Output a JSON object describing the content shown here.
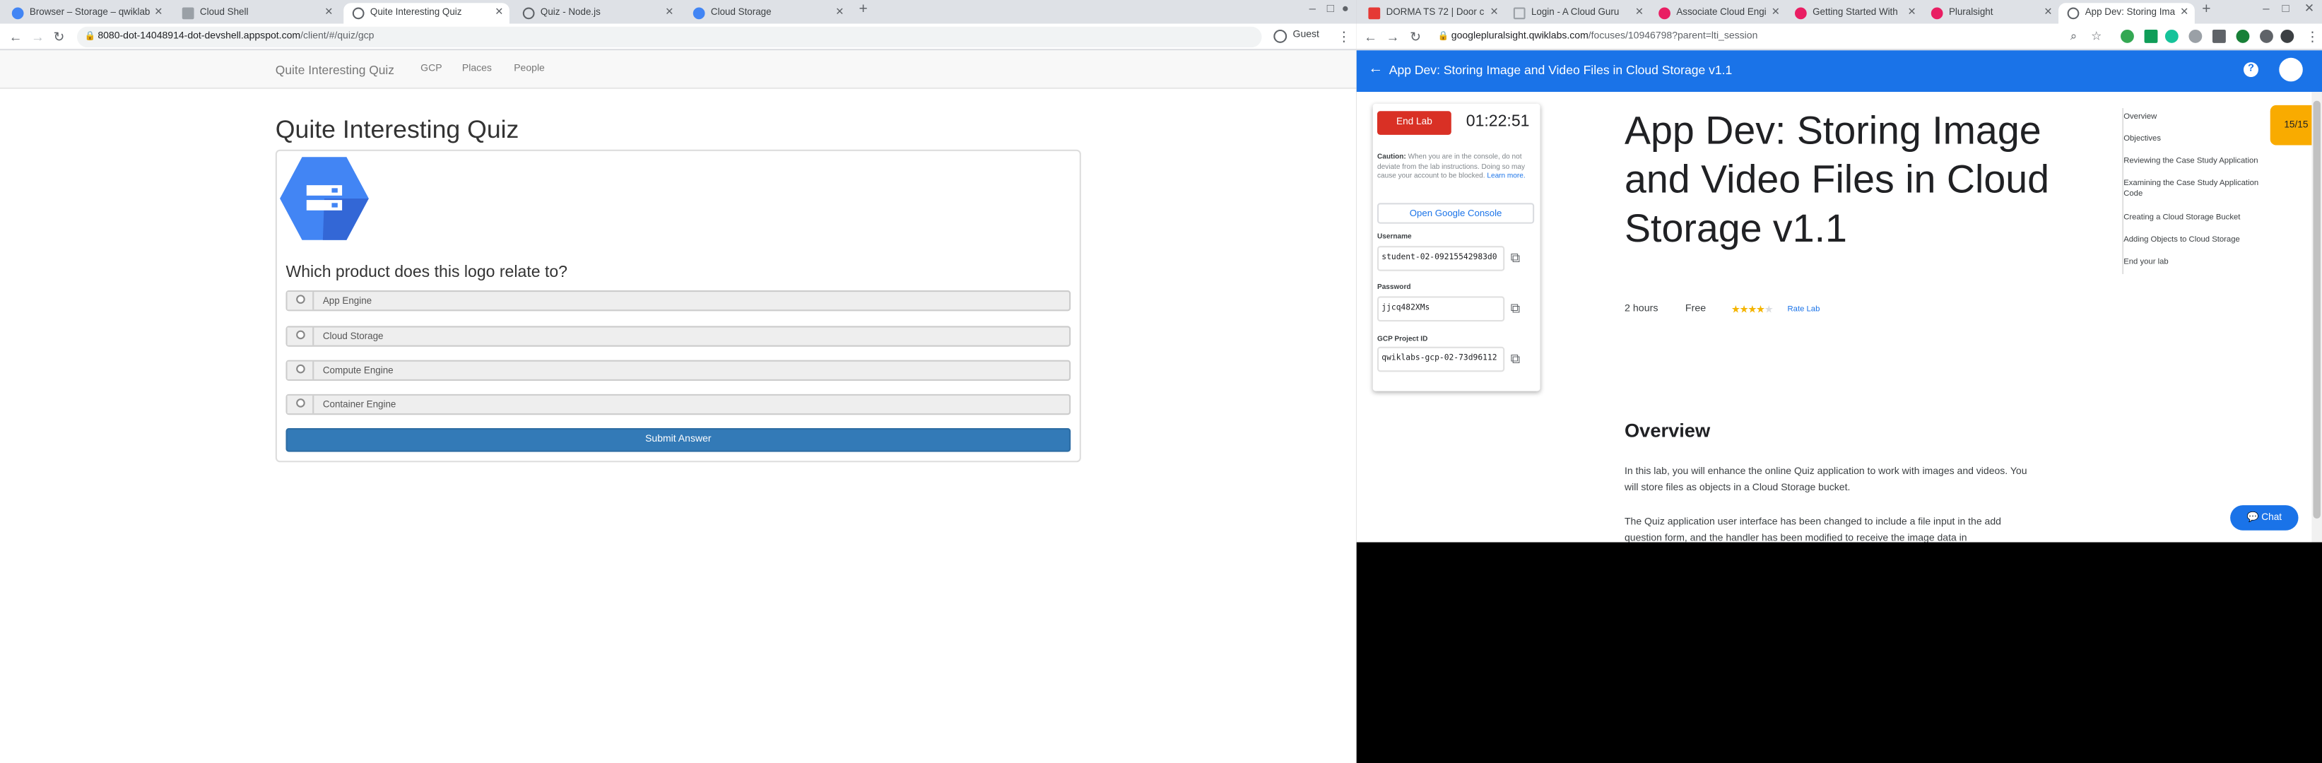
{
  "left_window": {
    "tabs": [
      {
        "label": "Browser – Storage – qwiklab"
      },
      {
        "label": "Cloud Shell"
      },
      {
        "label": "Quite Interesting Quiz"
      },
      {
        "label": "Quiz - Node.js"
      },
      {
        "label": "Cloud Storage"
      }
    ],
    "url_host": "8080-dot-14048914-dot-devshell.appspot.com",
    "url_path": "/client/#/quiz/gcp",
    "profile_label": "Guest",
    "app": {
      "brand": "Quite Interesting Quiz",
      "nav": [
        "GCP",
        "Places",
        "People"
      ],
      "heading": "Quite Interesting Quiz",
      "question": "Which product does this logo relate to?",
      "answers": [
        "App Engine",
        "Cloud Storage",
        "Compute Engine",
        "Container Engine"
      ],
      "submit_label": "Submit Answer"
    }
  },
  "right_window": {
    "tabs": [
      {
        "label": "DORMA TS 72 | Door c"
      },
      {
        "label": "Login - A Cloud Guru"
      },
      {
        "label": "Associate Cloud Engi"
      },
      {
        "label": "Getting Started With"
      },
      {
        "label": "Pluralsight"
      },
      {
        "label": "App Dev: Storing Ima"
      }
    ],
    "url_host": "googlepluralsight.qwiklabs.com",
    "url_path": "/focuses/10946798?parent=lti_session",
    "header_title": "App Dev: Storing Image and Video Files in Cloud Storage v1.1",
    "lab_panel": {
      "end_lab_label": "End Lab",
      "timer": "01:22:51",
      "caution_label": "Caution:",
      "caution_text": "When you are in the console, do not deviate from the lab instructions. Doing so may cause your account to be blocked.",
      "learn_more": "Learn more.",
      "open_console_label": "Open Google Console",
      "username_label": "Username",
      "username_value": "student-02-09215542983d0",
      "password_label": "Password",
      "password_value": "jjcq482XMs",
      "project_label": "GCP Project ID",
      "project_value": "qwiklabs-gcp-02-73d96112"
    },
    "lab_title": "App Dev: Storing Image and Video Files in Cloud Storage v1.1",
    "duration": "2 hours",
    "cost": "Free",
    "rating_stars": 4,
    "rate_lab_label": "Rate Lab",
    "toc": [
      "Overview",
      "Objectives",
      "Reviewing the Case Study Application",
      "Examining the Case Study Application Code",
      "Creating a Cloud Storage Bucket",
      "Adding Objects to Cloud Storage",
      "End your lab"
    ],
    "score": "15/15",
    "section_heading": "Overview",
    "paragraph_1": "In this lab, you will enhance the online Quiz application to work with images and videos. You will store files as objects in a Cloud Storage bucket.",
    "paragraph_2": "The Quiz application user interface has been changed to include a file input in the add question form, and the handler has been modified to receive the image data in",
    "chat_label": "Chat"
  },
  "colors": {
    "primary_blue": "#1a73e8",
    "end_lab_red": "#d93025",
    "score_amber": "#f9ab00",
    "bootstrap_blue": "#337ab7"
  }
}
